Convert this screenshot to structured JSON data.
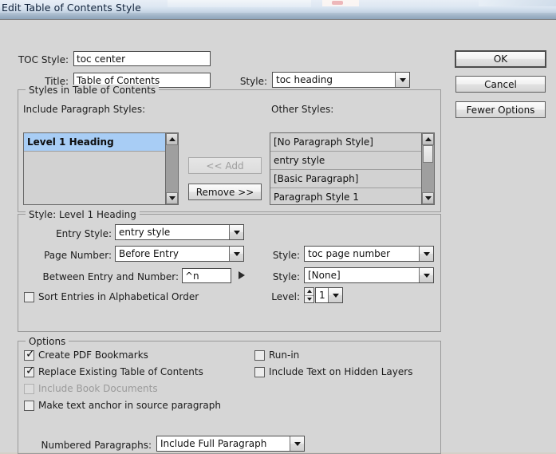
{
  "window": {
    "title": "Edit Table of Contents Style"
  },
  "form": {
    "toc_style_label": "TOC Style:",
    "toc_style_value": "toc center",
    "title_label": "Title:",
    "title_value": "Table of Contents",
    "title_style_label": "Style:",
    "title_style_value": "toc heading"
  },
  "buttons": {
    "ok": "OK",
    "cancel": "Cancel",
    "fewer_options": "Fewer Options",
    "add": "<< Add",
    "remove": "Remove >>"
  },
  "styles_group": {
    "legend": "Styles in Table of Contents",
    "include_label": "Include Paragraph Styles:",
    "other_label": "Other Styles:",
    "include_items": [
      {
        "label": "Level 1 Heading",
        "selected": true
      }
    ],
    "other_items": [
      {
        "label": "[No Paragraph Style]",
        "selected": false
      },
      {
        "label": "entry style",
        "selected": false
      },
      {
        "label": "[Basic Paragraph]",
        "selected": false
      },
      {
        "label": "Paragraph Style 1",
        "selected": false
      }
    ]
  },
  "style_group": {
    "legend": "Style: Level 1 Heading",
    "entry_style_label": "Entry Style:",
    "entry_style_value": "entry style",
    "page_number_label": "Page Number:",
    "page_number_value": "Before Entry",
    "page_number_style_label": "Style:",
    "page_number_style_value": "toc page number",
    "between_label": "Between Entry and Number:",
    "between_value": "^n",
    "between_style_label": "Style:",
    "between_style_value": "[None]",
    "sort_label": "Sort Entries in Alphabetical Order",
    "sort_checked": false,
    "level_label": "Level:",
    "level_value": "1"
  },
  "options_group": {
    "legend": "Options",
    "create_pdf_bookmarks": "Create PDF Bookmarks",
    "replace_existing_toc": "Replace Existing Table of Contents",
    "include_book_documents": "Include Book Documents",
    "make_text_anchor": "Make text anchor in source paragraph",
    "run_in": "Run-in",
    "include_hidden_layers": "Include Text on Hidden Layers",
    "numbered_paragraphs_label": "Numbered Paragraphs:",
    "numbered_paragraphs_value": "Include Full Paragraph"
  },
  "colors": {
    "dialog_bg": "#d6d6d6",
    "selection_blue": "#a8cdf5",
    "titlebar_top": "#e8eef6",
    "titlebar_bottom": "#a9bccd",
    "disabled_text": "#9a9a9a"
  }
}
